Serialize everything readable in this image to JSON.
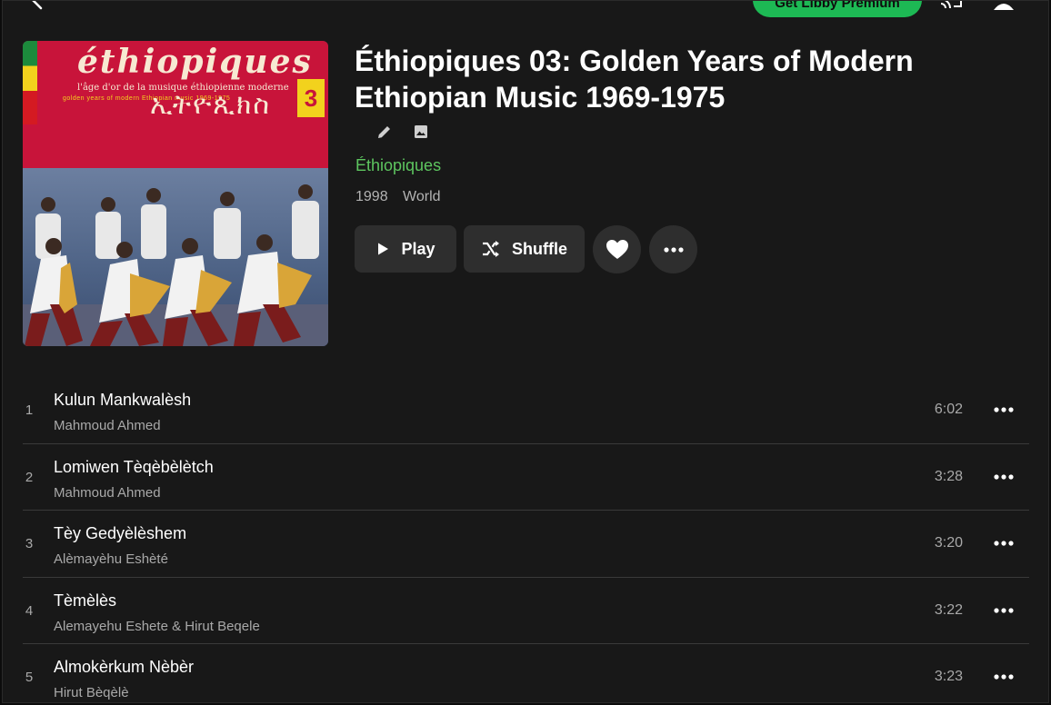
{
  "topbar": {
    "premium_label": "Get Libby Premium"
  },
  "album": {
    "title": "Éthiopiques 03: Golden Years of Modern Ethiopian Music 1969-1975",
    "artist": "Éthiopiques",
    "year": "1998",
    "genre": "World",
    "cover": {
      "title": "éthiopiques",
      "subtitle_fr": "l'âge d'or de la musique éthiopienne moderne",
      "subtitle_en": "golden years of modern Ethiopian music 1969-1975",
      "volume": "3",
      "script": "ኢትዮጲክስ"
    }
  },
  "actions": {
    "play_label": "Play",
    "shuffle_label": "Shuffle"
  },
  "tracks": [
    {
      "num": "1",
      "title": "Kulun Mankwalèsh",
      "artist": "Mahmoud Ahmed",
      "duration": "6:02"
    },
    {
      "num": "2",
      "title": "Lomiwen Tèqèbèlètch",
      "artist": "Mahmoud Ahmed",
      "duration": "3:28"
    },
    {
      "num": "3",
      "title": "Tèy Gedyèlèshem",
      "artist": "Alèmayèhu Eshèté",
      "duration": "3:20"
    },
    {
      "num": "4",
      "title": "Tèmèlès",
      "artist": "Alemayehu Eshete & Hirut Beqele",
      "duration": "3:22"
    },
    {
      "num": "5",
      "title": "Almokèrkum Nèbèr",
      "artist": "Hirut Bèqèlè",
      "duration": "3:23"
    }
  ],
  "colors": {
    "background": "#181818",
    "accent_green": "#5dc55f",
    "premium_green": "#1db954",
    "button_bg": "#2e2e2e",
    "muted_text": "#a9a9a9"
  }
}
